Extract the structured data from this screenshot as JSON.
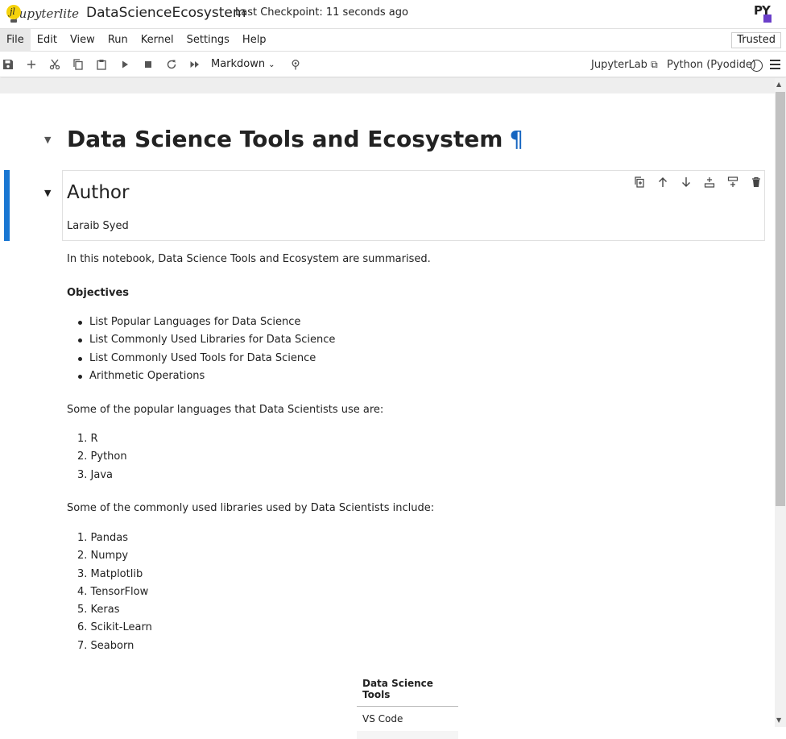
{
  "header": {
    "logo_text": "jupyterlite",
    "notebook_title": "DataScienceEcosystem",
    "checkpoint": "Last Checkpoint: 11 seconds ago",
    "py_logo": "PY"
  },
  "menubar": {
    "items": [
      "File",
      "Edit",
      "View",
      "Run",
      "Kernel",
      "Settings",
      "Help"
    ],
    "trusted": "Trusted"
  },
  "toolbar": {
    "cell_type": "Markdown",
    "jupyterlab_link": "JupyterLab",
    "kernel": "Python (Pyodide)",
    "icons": [
      "save-icon",
      "add-icon",
      "cut-icon",
      "copy-icon",
      "paste-icon",
      "run-icon",
      "stop-icon",
      "restart-icon",
      "fast-forward-icon",
      "debugger-icon"
    ]
  },
  "notebook": {
    "title": "Data Science Tools and Ecosystem",
    "pilcrow": "¶",
    "author_heading": "Author",
    "author_name": "Laraib Syed",
    "intro": "In this notebook, Data Science Tools and Ecosystem are summarised.",
    "objectives_heading": "Objectives",
    "objectives": [
      "List Popular Languages for Data Science",
      "List Commonly Used Libraries for Data Science",
      "List Commonly Used Tools for Data Science",
      "Arithmetic Operations"
    ],
    "languages_intro": "Some of the popular languages that Data Scientists use are:",
    "languages": [
      "1. R",
      "2. Python",
      "3. Java"
    ],
    "libraries_intro": "Some of the commonly used libraries used by Data Scientists include:",
    "libraries": [
      "1. Pandas",
      "2. Numpy",
      "3. Matplotlib",
      "4. TensorFlow",
      "5. Keras",
      "6. Scikit-Learn",
      "7. Seaborn"
    ],
    "tools_table": {
      "header": "Data Science Tools",
      "rows": [
        "VS Code"
      ]
    }
  }
}
